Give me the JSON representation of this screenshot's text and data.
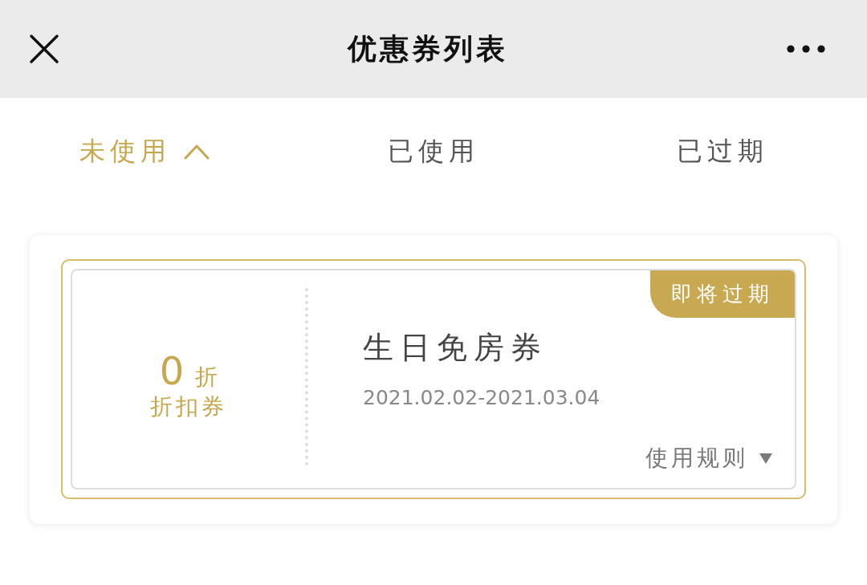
{
  "header": {
    "title": "优惠券列表"
  },
  "tabs": [
    {
      "label": "未使用",
      "selected": true
    },
    {
      "label": "已使用",
      "selected": false
    },
    {
      "label": "已过期",
      "selected": false
    }
  ],
  "coupons": [
    {
      "value": "0",
      "unit": "折",
      "type_label": "折扣券",
      "title": "生日免房券",
      "validity": "2021.02.02-2021.03.04",
      "badge": "即将过期",
      "rules_link": "使用规则"
    }
  ]
}
